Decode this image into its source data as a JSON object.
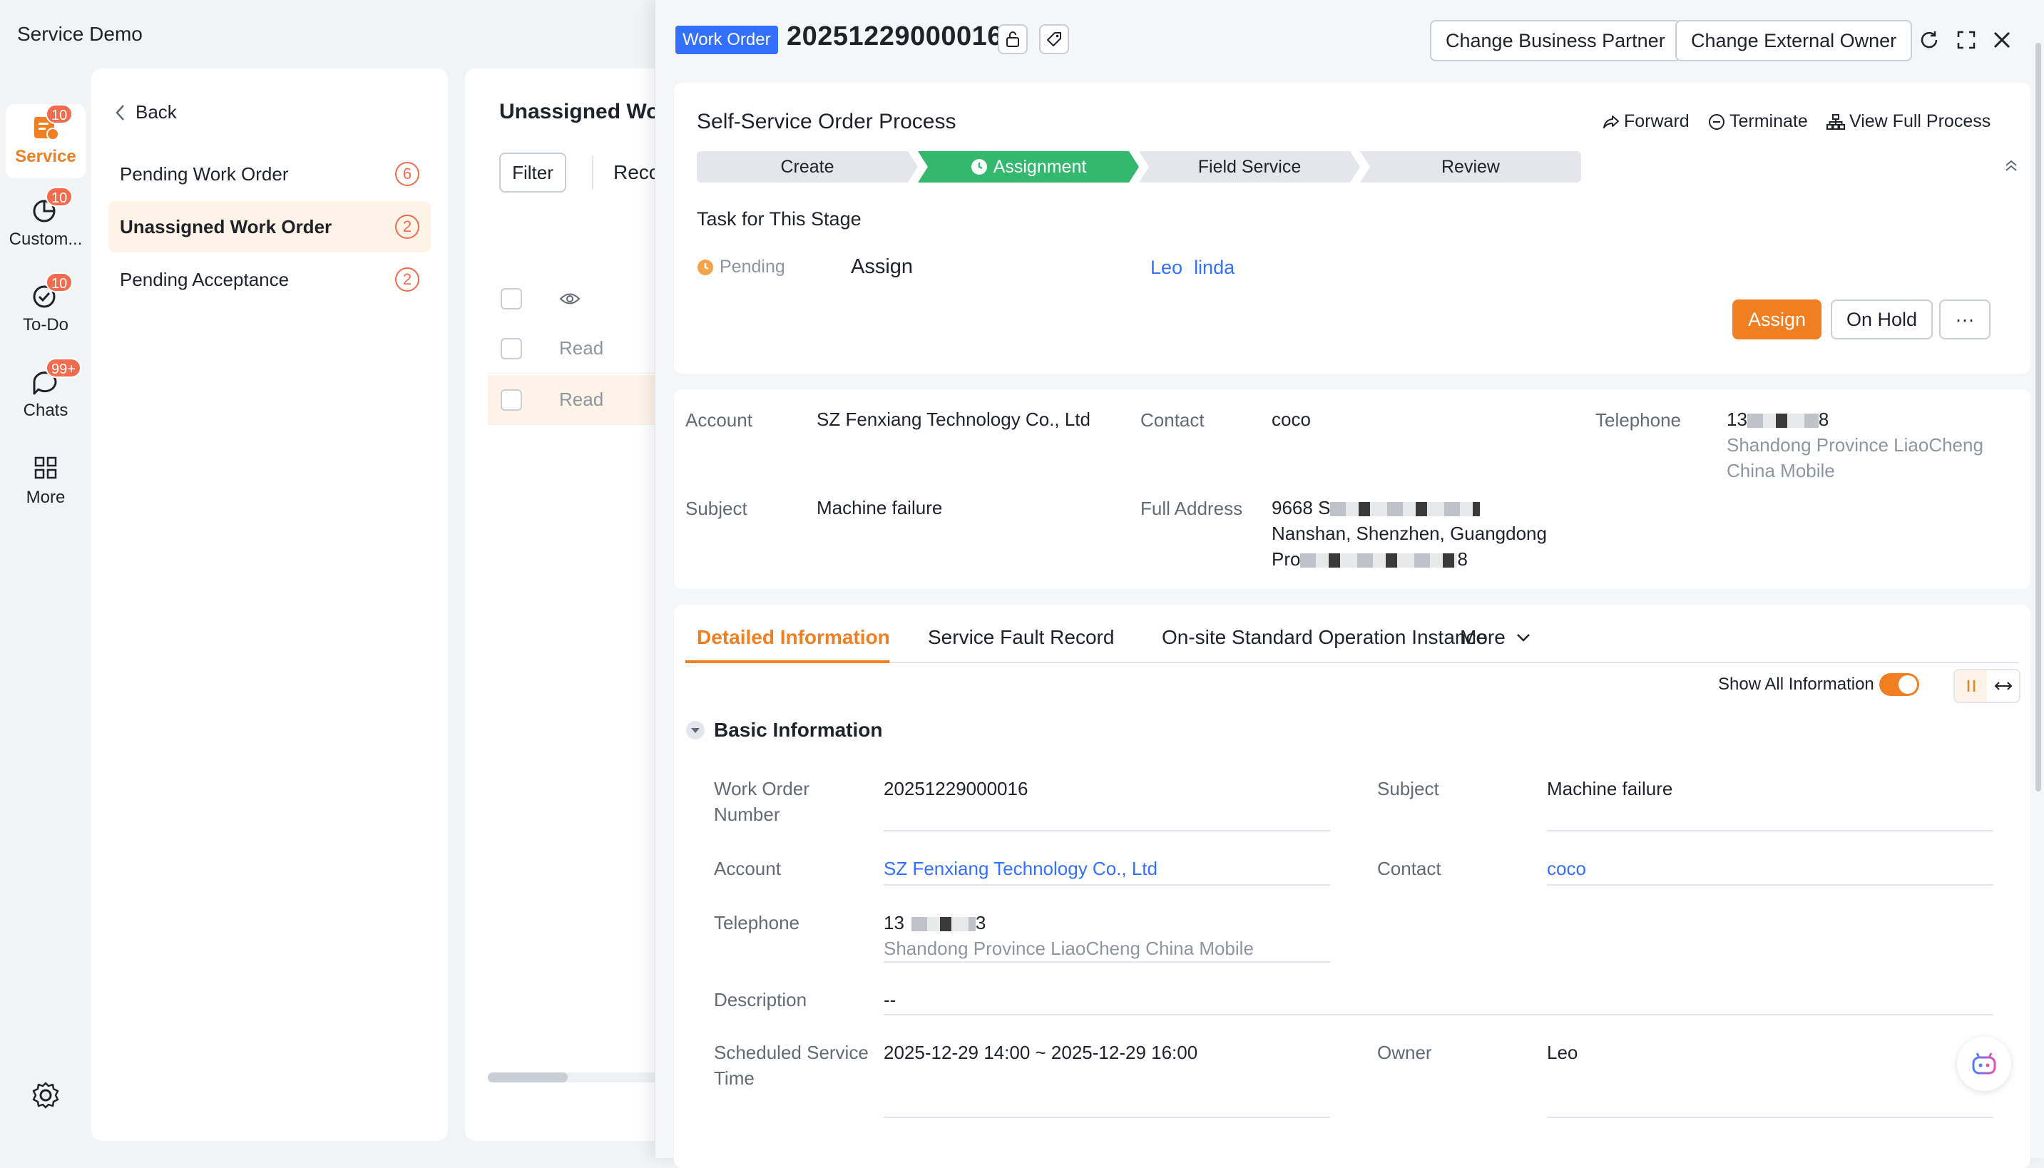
{
  "app": {
    "title": "Service Demo"
  },
  "nav": {
    "items": [
      {
        "label": "Service",
        "badge": "10",
        "icon": "service-icon"
      },
      {
        "label": "Custom...",
        "badge": "10",
        "icon": "customer-chart-icon"
      },
      {
        "label": "To-Do",
        "badge": "10",
        "icon": "check-circle-icon"
      },
      {
        "label": "Chats",
        "badge": "99+",
        "icon": "chat-bubble-icon"
      },
      {
        "label": "More",
        "badge": "",
        "icon": "grid-icon"
      }
    ],
    "settings_icon": "gear-icon"
  },
  "sidebar": {
    "back_label": "Back",
    "items": [
      {
        "label": "Pending Work Order",
        "count": "6"
      },
      {
        "label": "Unassigned Work Order",
        "count": "2"
      },
      {
        "label": "Pending Acceptance",
        "count": "2"
      }
    ]
  },
  "list": {
    "title": "Unassigned Wo",
    "filter_label": "Filter",
    "record_label": "Reco",
    "rows": [
      {
        "status": "Read"
      },
      {
        "status": "Read"
      }
    ]
  },
  "drawer": {
    "tag": "Work Order",
    "number": "20251229000016",
    "buttons": {
      "change_partner": "Change Business Partner",
      "change_owner": "Change External Owner"
    },
    "process": {
      "title": "Self-Service Order Process",
      "actions": {
        "forward": "Forward",
        "terminate": "Terminate",
        "view_full": "View Full Process"
      },
      "stages": [
        "Create",
        "Assignment",
        "Field Service",
        "Review"
      ],
      "current_stage": "Assignment",
      "task_label": "Task for This Stage",
      "task_status": "Pending",
      "task_name": "Assign",
      "assignees": [
        "Leo",
        "linda"
      ],
      "assign_btn": "Assign",
      "on_hold_btn": "On Hold",
      "more_btn": "···"
    },
    "summary": {
      "account_label": "Account",
      "account": "SZ Fenxiang Technology Co., Ltd",
      "contact_label": "Contact",
      "contact": "coco",
      "telephone_label": "Telephone",
      "telephone_prefix": "13",
      "telephone_suffix": "8",
      "telephone_carrier": "Shandong Province LiaoCheng China Mobile",
      "subject_label": "Subject",
      "subject": "Machine failure",
      "address_label": "Full Address",
      "address_line1_prefix": "9668 S",
      "address_line2": "Nanshan, Shenzhen, Guangdong",
      "address_line3_prefix": "Pro",
      "address_line3_suffix": "8"
    },
    "tabs": [
      "Detailed Information",
      "Service Fault Record",
      "On-site Standard Operation Instance",
      "More"
    ],
    "show_all_label": "Show All Information",
    "show_all_on": true,
    "basic": {
      "section_title": "Basic Information",
      "wo_number_label": "Work Order Number",
      "wo_number": "20251229000016",
      "subject_label": "Subject",
      "subject": "Machine failure",
      "account_label": "Account",
      "account": "SZ Fenxiang Technology Co., Ltd",
      "contact_label": "Contact",
      "contact": "coco",
      "telephone_label": "Telephone",
      "telephone_prefix": "13",
      "telephone_suffix": "3",
      "telephone_carrier": "Shandong Province LiaoCheng China Mobile",
      "description_label": "Description",
      "description": "--",
      "scheduled_label": "Scheduled Service Time",
      "scheduled": "2025-12-29 14:00 ~ 2025-12-29 16:00",
      "owner_label": "Owner",
      "owner": "Leo"
    }
  },
  "colors": {
    "accent": "#f07f22",
    "link": "#3370ff",
    "stage_active": "#34b86e",
    "badge": "#f26b4f"
  }
}
